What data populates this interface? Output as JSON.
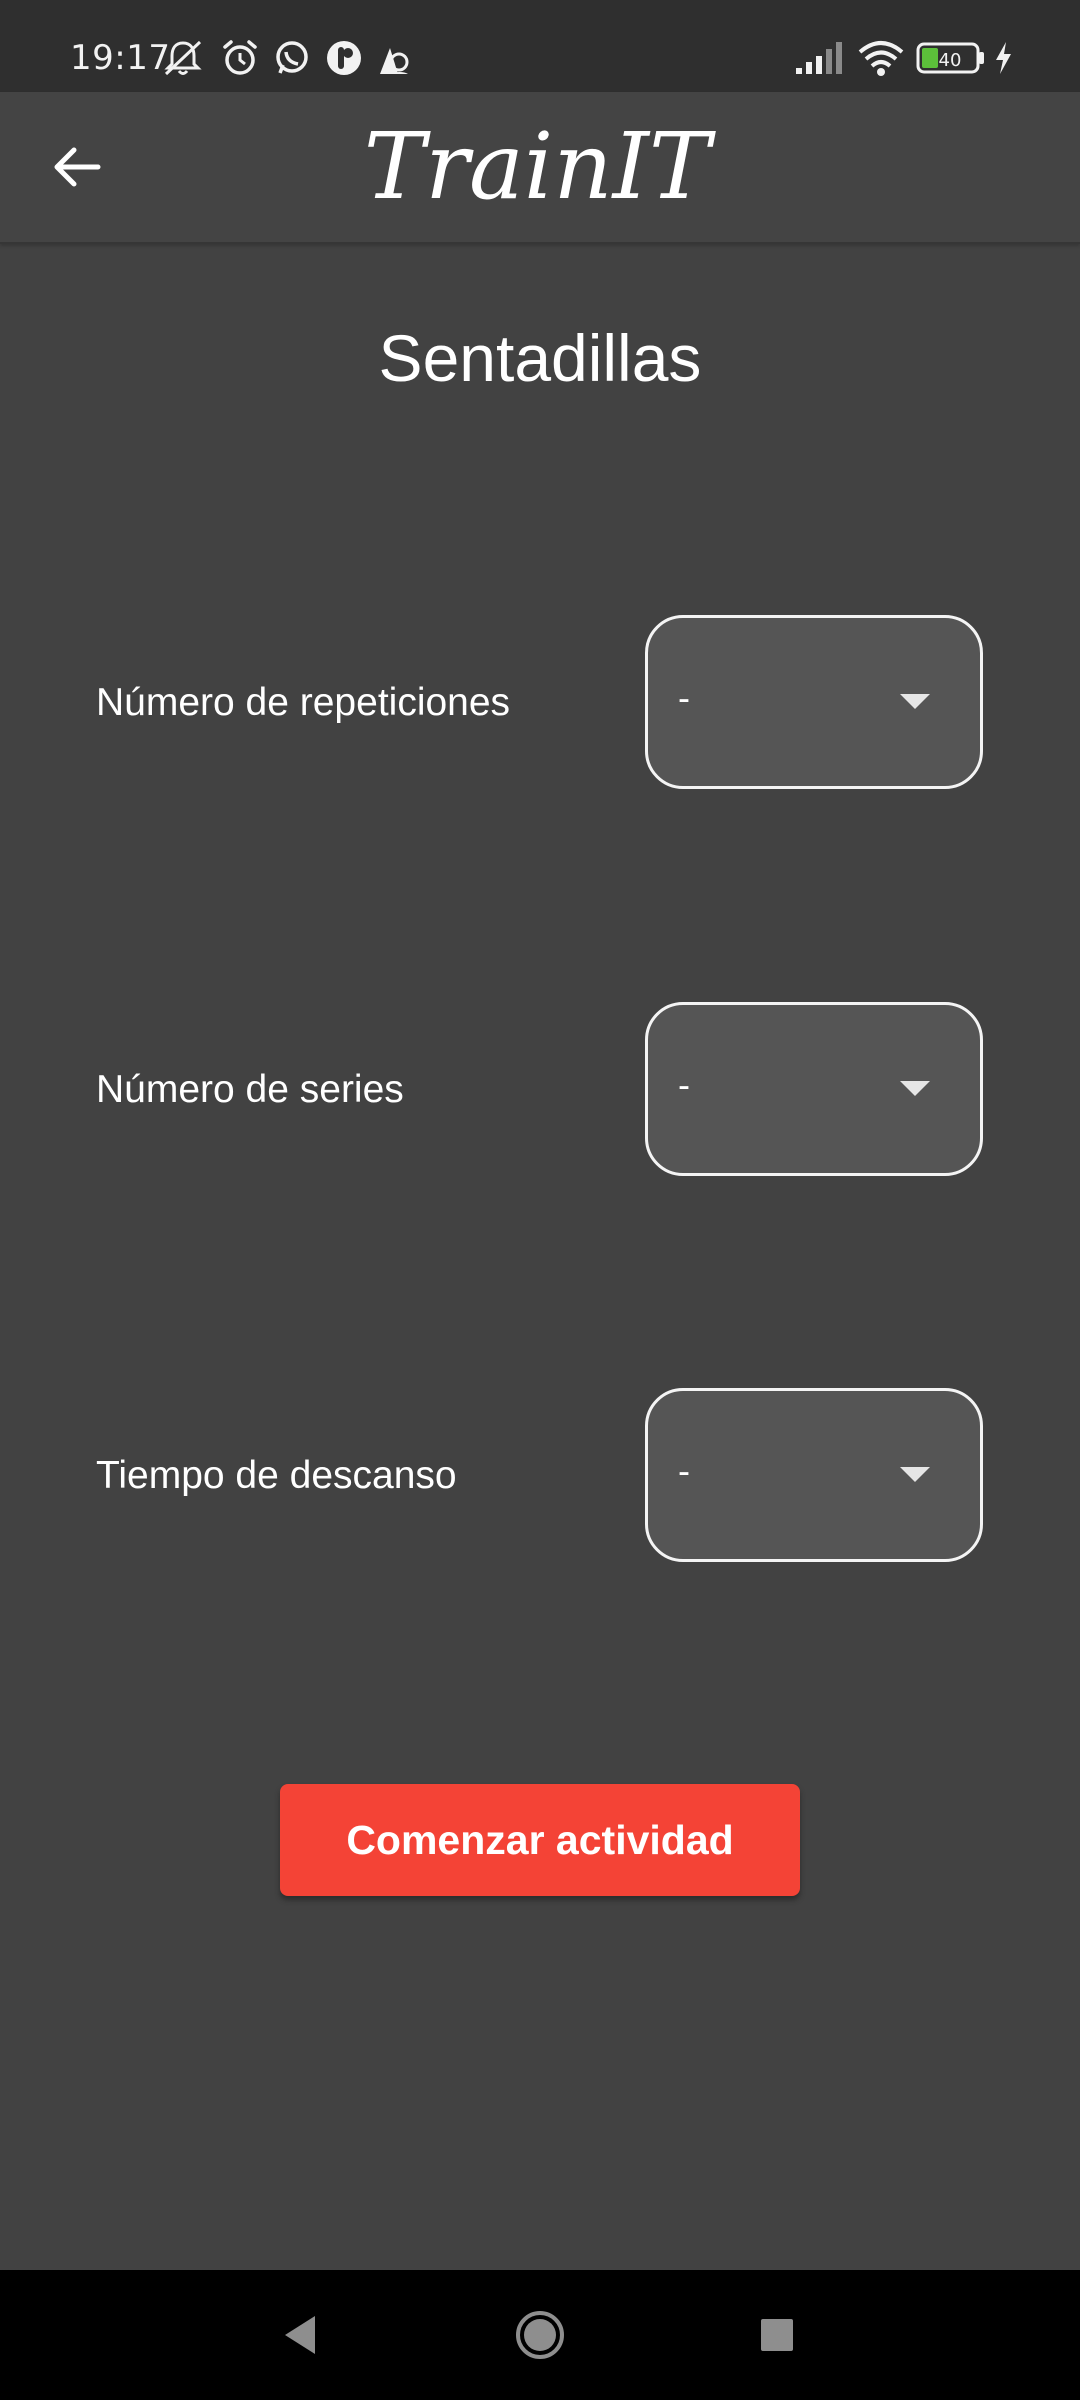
{
  "status_bar": {
    "time": "19:17",
    "battery": "40",
    "icons": [
      "mute-icon",
      "alarm-icon",
      "whatsapp-icon",
      "app-notification-icon",
      "location-icon",
      "signal-icon",
      "wifi-icon",
      "battery-icon",
      "charging-icon"
    ]
  },
  "app_bar": {
    "title": "TrainIT",
    "back_icon": "arrow-left-icon"
  },
  "page": {
    "title": "Sentadillas",
    "fields": [
      {
        "label": "Número de repeticiones",
        "value": "-"
      },
      {
        "label": "Número de series",
        "value": "-"
      },
      {
        "label": "Tiempo de descanso",
        "value": "-"
      }
    ],
    "start_button": "Comenzar actividad"
  },
  "colors": {
    "background": "#424242",
    "app_bar": "#444444",
    "accent": "#f44336",
    "dropdown_fill": "#555555"
  },
  "nav_bar": {
    "icons": [
      "back-triangle-icon",
      "home-circle-icon",
      "recents-square-icon"
    ]
  }
}
